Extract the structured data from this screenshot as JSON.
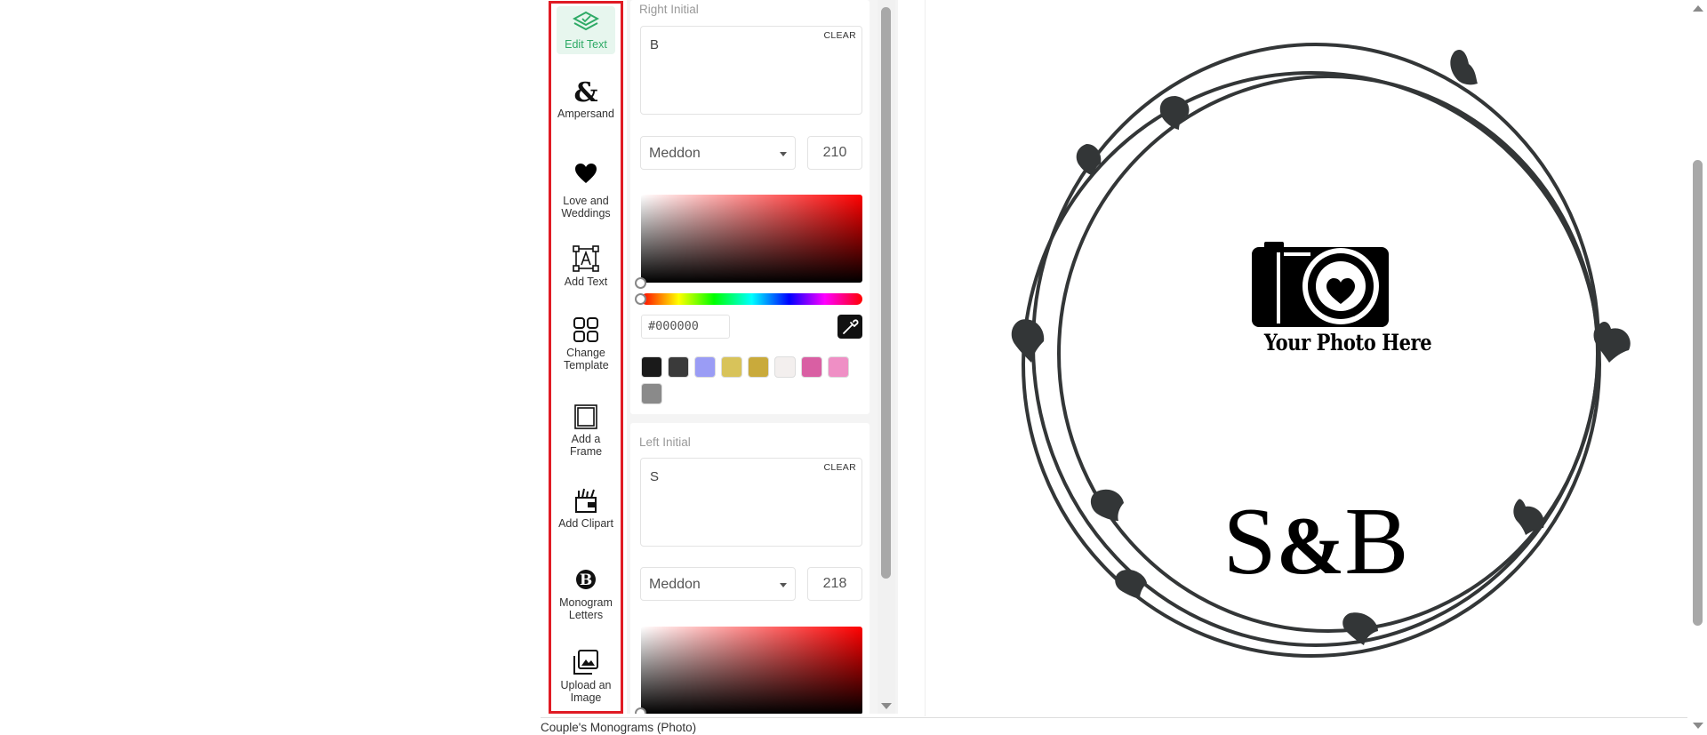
{
  "toolbar": {
    "items": [
      {
        "label": "Edit Text",
        "icon": "edit-text-layers-icon"
      },
      {
        "label": "Ampersand",
        "icon": "ampersand-icon"
      },
      {
        "label": "Love and Weddings",
        "icon": "heart-icon"
      },
      {
        "label": "Add Text",
        "icon": "add-text-icon"
      },
      {
        "label": "Change Template",
        "icon": "grid-icon"
      },
      {
        "label": "Add a Frame",
        "icon": "frame-icon"
      },
      {
        "label": "Add Clipart",
        "icon": "clipart-icon"
      },
      {
        "label": "Monogram Letters",
        "icon": "monogram-b-icon"
      },
      {
        "label": "Upload an Image",
        "icon": "image-upload-icon"
      }
    ],
    "active": "Edit Text",
    "active_color": "#2eaa66",
    "highlight_border_color": "#e01b24"
  },
  "editor": {
    "right_initial": {
      "label": "Right Initial",
      "value": "B",
      "clear_label": "CLEAR",
      "font": "Meddon",
      "size": "210",
      "hex": "#000000"
    },
    "left_initial": {
      "label": "Left Initial",
      "value": "S",
      "clear_label": "CLEAR",
      "font": "Meddon",
      "size": "218"
    },
    "swatches": [
      "black-marble",
      "charcoal",
      "periwinkle",
      "gold-glitter",
      "gold",
      "white-marble",
      "pink-marble",
      "pink",
      "black-white-marble"
    ],
    "swatch_colors": [
      "#1a1a1a",
      "#3a3a3a",
      "#9a9cf5",
      "#d8c35a",
      "#c9aa3b",
      "#f3efee",
      "#d95fa3",
      "#ef8fc5",
      "#8a8a8a"
    ]
  },
  "canvas": {
    "photo_caption": "Your Photo Here",
    "monogram": {
      "left": "S",
      "amp": "&",
      "right": "B"
    },
    "frame_color": "#333637"
  },
  "footer": {
    "caption": "Couple's Monograms (Photo)"
  }
}
